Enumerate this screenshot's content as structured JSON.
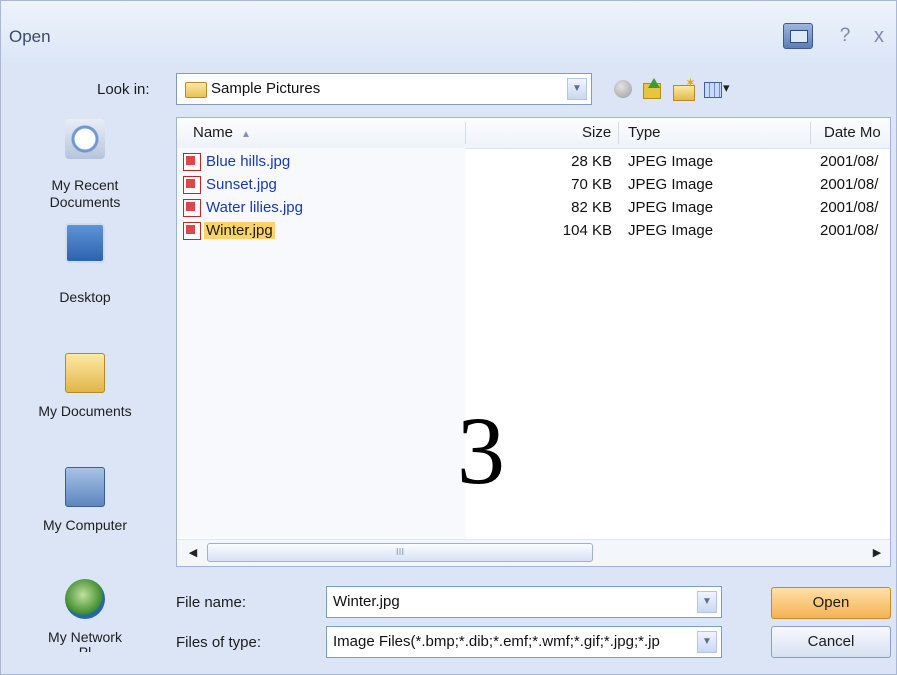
{
  "window": {
    "title": "Open",
    "help_glyph": "?",
    "close_glyph": "x"
  },
  "toolbar": {
    "look_in_label": "Look in:",
    "look_in_value": "Sample Pictures"
  },
  "places": [
    {
      "label_line1": "My Recent",
      "label_line2": "Documents",
      "icon": "recent-documents-icon"
    },
    {
      "label_line1": "Desktop",
      "label_line2": "",
      "icon": "desktop-icon"
    },
    {
      "label_line1": "My Documents",
      "label_line2": "",
      "icon": "my-documents-icon"
    },
    {
      "label_line1": "My Computer",
      "label_line2": "",
      "icon": "my-computer-icon"
    },
    {
      "label_line1": "My Network",
      "label_line2": "Pl",
      "icon": "my-network-icon"
    }
  ],
  "list": {
    "columns": {
      "name": "Name",
      "size": "Size",
      "type": "Type",
      "date": "Date Mo"
    },
    "rows": [
      {
        "name": "Blue hills.jpg",
        "size": "28 KB",
        "type": "JPEG Image",
        "date": "2001/08/"
      },
      {
        "name": "Sunset.jpg",
        "size": "70 KB",
        "type": "JPEG Image",
        "date": "2001/08/"
      },
      {
        "name": "Water lilies.jpg",
        "size": "82 KB",
        "type": "JPEG Image",
        "date": "2001/08/"
      },
      {
        "name": "Winter.jpg",
        "size": "104 KB",
        "type": "JPEG Image",
        "date": "2001/08/",
        "selected": true
      }
    ],
    "overlay_number": "3",
    "scroll_grip": "III"
  },
  "file_name": {
    "label": "File name:",
    "value": "Winter.jpg"
  },
  "file_type": {
    "label": "Files of type:",
    "value": "Image Files(*.bmp;*.dib;*.emf;*.wmf;*.gif;*.jpg;*.jp"
  },
  "buttons": {
    "open": "Open",
    "cancel": "Cancel"
  },
  "colors": {
    "selection": "#ffd36b",
    "open_button": "#f4b352",
    "link_text": "#1a3aa8"
  }
}
